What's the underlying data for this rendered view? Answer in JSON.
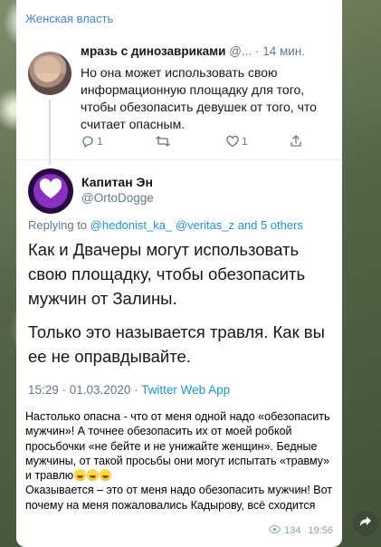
{
  "channel": {
    "name": "Женская власть"
  },
  "quoted_tweet": {
    "name": "мразь с динозавриками",
    "handle": "@...",
    "time": "· 14 мин.",
    "text": "Но она может использовать свою информационную площадку для того, чтобы обезопасить девушек от того, что считает опасным.",
    "replies": "1",
    "retweets": "",
    "likes": "1"
  },
  "main_tweet": {
    "name": "Капитан Эн",
    "handle": "@OrtoDogge",
    "replying_prefix": "Replying to",
    "replying_targets": "@hedonist_ka_ @veritas_z and 5 others",
    "paragraph1": "Как и Двачеры могут использовать свою площадку, чтобы обезопасить мужчин от Залины.",
    "paragraph2": "Только это называется травля. Как вы ее не оправдывайте.",
    "datetime": "15:29 · 01.03.2020 ·",
    "source": "Twitter Web App"
  },
  "caption": {
    "text1": "Настолько опасна - что от меня одной надо «обезопасить мужчин»! А точнее обезопасить их от моей робкой просьбочки «не бейте и не унижайте женщин». Бедные мужчины, от такой просьбы они могут испытать «травму» и травлю",
    "text2": "Оказывается – это от меня надо обезопасить мужчин! Вот почему на меня пожаловались Кадырову, всё сходится"
  },
  "message_meta": {
    "views": "134",
    "time": "19:56"
  },
  "colors": {
    "link": "#1b95e0",
    "channel_link": "#3b8ad1",
    "avatar_purple": "#8a2fc0"
  }
}
